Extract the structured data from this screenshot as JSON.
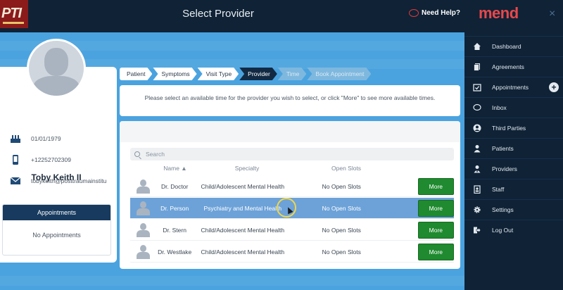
{
  "header": {
    "logo_text": "PTI",
    "title": "Select Provider",
    "help_label": "Need Help?"
  },
  "profile": {
    "name": "Toby Keith II",
    "birthdate": "01/01/1979",
    "phone": "+12252702309",
    "email": "tobykeith@posttraumainstitu",
    "appointments_title": "Appointments",
    "appointments_empty": "No Appointments"
  },
  "steps": [
    {
      "label": "Patient",
      "state": "done"
    },
    {
      "label": "Symptoms",
      "state": "done"
    },
    {
      "label": "Visit Type",
      "state": "done"
    },
    {
      "label": "Provider",
      "state": "active"
    },
    {
      "label": "Time",
      "state": "pending"
    },
    {
      "label": "Book Appointment",
      "state": "pending"
    }
  ],
  "instructions": "Please select an available time for the provider you wish to select, or click \"More\" to see more available times.",
  "table": {
    "search_placeholder": "Search",
    "columns": {
      "name": "Name ▲",
      "specialty": "Specialty",
      "open_slots": "Open Slots"
    },
    "rows": [
      {
        "name": "Dr. Doctor",
        "specialty": "Child/Adolescent Mental Health",
        "open_slots": "No Open Slots",
        "action": "More",
        "selected": false
      },
      {
        "name": "Dr. Person",
        "specialty": "Psychiatry and Mental Health",
        "open_slots": "No Open Slots",
        "action": "More",
        "selected": true
      },
      {
        "name": "Dr. Stern",
        "specialty": "Child/Adolescent Mental Health",
        "open_slots": "No Open Slots",
        "action": "More",
        "selected": false
      },
      {
        "name": "Dr. Westlake",
        "specialty": "Child/Adolescent Mental Health",
        "open_slots": "No Open Slots",
        "action": "More",
        "selected": false
      }
    ]
  },
  "nav": {
    "brand": "mend",
    "close": "×",
    "items": [
      {
        "label": "Dashboard",
        "icon": "home-icon"
      },
      {
        "label": "Agreements",
        "icon": "documents-icon"
      },
      {
        "label": "Appointments",
        "icon": "calendar-check-icon"
      },
      {
        "label": "Inbox",
        "icon": "chat-bubble-icon"
      },
      {
        "label": "Third Parties",
        "icon": "person-circle-icon"
      },
      {
        "label": "Patients",
        "icon": "person-icon"
      },
      {
        "label": "Providers",
        "icon": "doctor-icon"
      },
      {
        "label": "Staff",
        "icon": "badge-icon"
      },
      {
        "label": "Settings",
        "icon": "gear-icon"
      },
      {
        "label": "Log Out",
        "icon": "logout-icon"
      }
    ],
    "appointments_add": "+"
  },
  "colors": {
    "background": "#4aa3df",
    "navy": "#0f2236",
    "button_green": "#1f8a2f",
    "row_selected": "#6da2d8",
    "brand_red": "#e8484c"
  }
}
